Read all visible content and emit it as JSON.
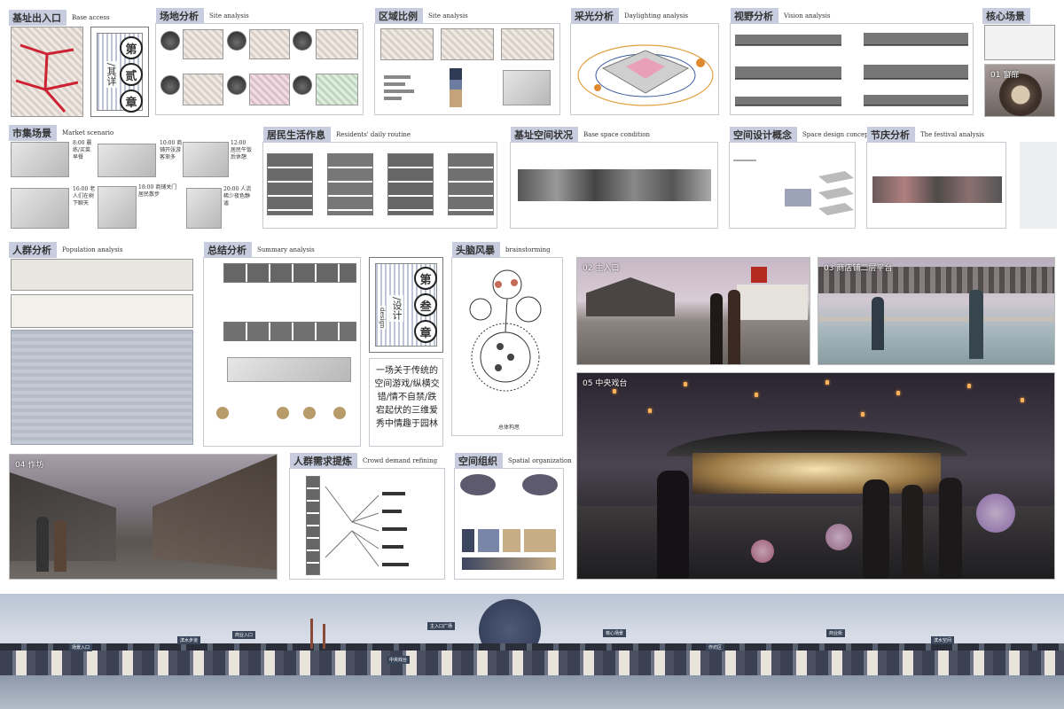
{
  "panels": {
    "base_access": {
      "zh": "基址出入口",
      "en": "Base access"
    },
    "site_analysis": {
      "zh": "场地分析",
      "en": "Site analysis"
    },
    "regional_scale": {
      "zh": "区域比例",
      "en": "Site analysis"
    },
    "daylighting": {
      "zh": "采光分析",
      "en": "Daylighting analysis"
    },
    "vision": {
      "zh": "视野分析",
      "en": "Vision analysis"
    },
    "core_scene": {
      "zh": "核心场景"
    },
    "market": {
      "zh": "市集场景",
      "en": "Market scenario"
    },
    "residents": {
      "zh": "居民生活作息",
      "en": "Residents' daily routine"
    },
    "base_space": {
      "zh": "基址空间状况",
      "en": "Base space condition"
    },
    "space_concept": {
      "zh": "空间设计概念",
      "en": "Space design concept"
    },
    "festival": {
      "zh": "节庆分析",
      "en": "The festival analysis"
    },
    "population": {
      "zh": "人群分析",
      "en": "Population analysis"
    },
    "summary": {
      "zh": "总结分析",
      "en": "Summary analysis"
    },
    "brainstorm": {
      "zh": "头脑风暴",
      "en": "brainstorming"
    },
    "crowd": {
      "zh": "人群需求提炼",
      "en": "Crowd demand refining"
    },
    "spatial_org": {
      "zh": "空间组织",
      "en": "Spatial organization"
    }
  },
  "chapter2": {
    "seal_top": "第",
    "seal_mid": "贰",
    "seal_bot": "章",
    "vertical": "/其详"
  },
  "chapter3": {
    "seal_top": "第",
    "seal_mid": "叁",
    "seal_bot": "章",
    "vertical": "/设计",
    "vertical_en": "design"
  },
  "scenes": {
    "s01": "01 窗扉",
    "s02": "02 主入口",
    "s03": "03 商店铺二层平台",
    "s04": "04 作坊",
    "s05": "05 中央戏台"
  },
  "market_times": [
    {
      "time": "8:00",
      "text": "晨练/买菜早餐"
    },
    {
      "time": "10:00",
      "text": "商铺开张游客渐多"
    },
    {
      "time": "12:00",
      "text": "居民午饭后休憩"
    },
    {
      "time": "16:00",
      "text": "老人们在树下聊天"
    },
    {
      "time": "18:00",
      "text": "商铺关门居民散步"
    },
    {
      "time": "20:00",
      "text": "人流稀少夜色静谧"
    }
  ],
  "poem": "一场关于传统的空间游戏/纵横交错/情不自禁/跌宕起伏的三维爱秀中情趣于园林",
  "brainstorm_caption": "总体构思",
  "panorama_labels": [
    "场景入口",
    "滨水步道",
    "商业入口",
    "中央戏台",
    "主入口广场",
    "核心场景",
    "作坊区",
    "商业街",
    "滨水空间"
  ]
}
